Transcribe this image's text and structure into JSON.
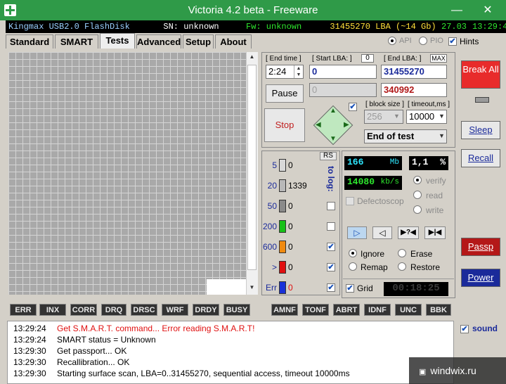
{
  "window": {
    "title": "Victoria 4.2 beta - Freeware",
    "minimize": "—",
    "close": "✕"
  },
  "infobar": {
    "model": "Kingmax USB2.0 FlashDisk",
    "serial": "SN: unknown",
    "firmware": "Fw: unknown",
    "size": "31455270 LBA (~14 Gb)",
    "date": "27.03",
    "time": "13:29:4"
  },
  "tabs": [
    "Standard",
    "SMART",
    "Tests",
    "Advanced",
    "Setup",
    "About"
  ],
  "active_tab": "Tests",
  "mode": {
    "api_label": "API",
    "pio_label": "PIO",
    "hints_label": "Hints",
    "hints_checked": true,
    "selected": "API"
  },
  "test": {
    "end_time_label": "[ End time ]",
    "end_time_value": "2:24",
    "start_lba_label": "[ Start LBA: ]",
    "start_lba_zero": "0",
    "start_lba_value": "0",
    "start_lba_current": "0",
    "end_lba_label": "[ End LBA: ]",
    "end_lba_max": "MAX",
    "end_lba_value": "31455270",
    "current_lba": "340992",
    "pause_label": "Pause",
    "stop_label": "Stop",
    "block_size_label": "[ block size ]",
    "block_size_value": "256",
    "timeout_label": "[ timeout,ms ]",
    "timeout_value": "10000",
    "end_action": "End of test"
  },
  "legend": {
    "rs_label": "RS",
    "to_log_label": "to log:",
    "rows": [
      {
        "label": "5",
        "count": "0",
        "color": "#d8d8d8",
        "log": false
      },
      {
        "label": "20",
        "count": "1339",
        "color": "#b8b8b8",
        "log": false
      },
      {
        "label": "50",
        "count": "0",
        "color": "#8a8a8a",
        "log": false
      },
      {
        "label": "200",
        "count": "0",
        "color": "#18c018",
        "log": false
      },
      {
        "label": "600",
        "count": "0",
        "color": "#f08a10",
        "log": true
      },
      {
        "label": ">",
        "count": "0",
        "color": "#e01010",
        "log": true
      },
      {
        "label": "Err",
        "count": "0",
        "color": "#1830d8",
        "log": true
      }
    ]
  },
  "stats": {
    "mb_value": "166",
    "mb_unit": "Mb",
    "percent_value": "1,1",
    "percent_unit": "%",
    "speed_value": "14080",
    "speed_unit": "kb/s",
    "defectoscop_label": "Defectoscop",
    "verify_label": "verify",
    "read_label": "read",
    "write_label": "write",
    "selected_op": "verify"
  },
  "actions": {
    "ignore_label": "Ignore",
    "erase_label": "Erase",
    "remap_label": "Remap",
    "restore_label": "Restore",
    "selected": "Ignore",
    "grid_label": "Grid",
    "grid_checked": true,
    "timer": "00:18:25"
  },
  "status_flags": [
    "ERR",
    "INX",
    "CORR",
    "DRQ",
    "DRSC",
    "WRF",
    "DRDY",
    "BUSY",
    "AMNF",
    "TONF",
    "ABRT",
    "IDNF",
    "UNC",
    "BBK"
  ],
  "log": [
    {
      "time": "13:29:24",
      "text": "Get S.M.A.R.T. command... Error reading S.M.A.R.T!",
      "color": "#e01010"
    },
    {
      "time": "13:29:24",
      "text": "SMART status = Unknown",
      "color": "#000000"
    },
    {
      "time": "13:29:30",
      "text": "Get passport... OK",
      "color": "#000000"
    },
    {
      "time": "13:29:30",
      "text": "Recallibration... OK",
      "color": "#000000"
    },
    {
      "time": "13:29:30",
      "text": "Starting surface scan, LBA=0..31455270, sequential access, timeout 10000ms",
      "color": "#000000"
    }
  ],
  "side_buttons": {
    "break_all": "Break All",
    "sleep": "Sleep",
    "recall": "Recall",
    "passp": "Passp",
    "power": "Power",
    "sound_label": "sound",
    "sound_checked": true
  },
  "watermark": "windwix.ru"
}
